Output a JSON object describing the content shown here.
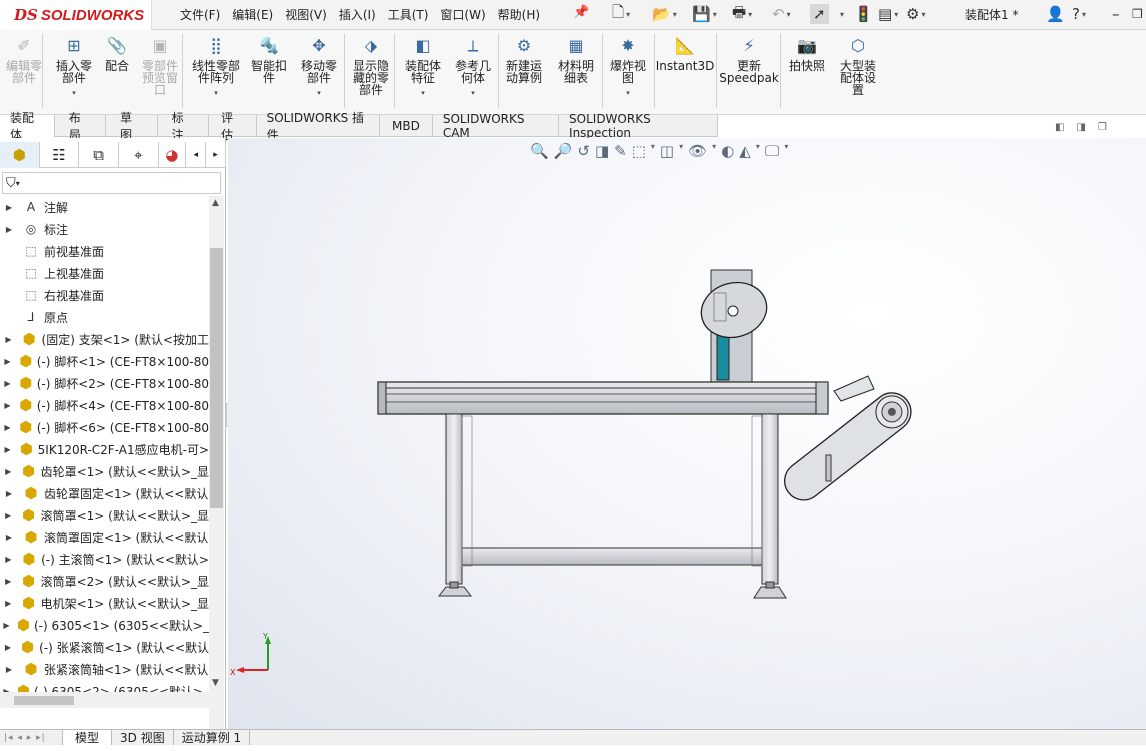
{
  "app": {
    "logo_ds": "DS",
    "logo_name": "SOLIDWORKS",
    "doc_title": "装配体1 *"
  },
  "menu": [
    "文件(F)",
    "编辑(E)",
    "视图(V)",
    "插入(I)",
    "工具(T)",
    "窗口(W)",
    "帮助(H)"
  ],
  "ribbon": [
    {
      "label": "编辑零\n部件",
      "disabled": true,
      "icon": "edit-component-icon"
    },
    {
      "label": "插入零\n部件",
      "disabled": false,
      "icon": "insert-component-icon",
      "dropdown": true
    },
    {
      "label": "配合",
      "disabled": false,
      "icon": "mate-icon"
    },
    {
      "label": "零部件\n预览窗\n口",
      "disabled": true,
      "icon": "component-preview-icon"
    },
    {
      "label": "线性零部\n件阵列",
      "disabled": false,
      "icon": "linear-pattern-icon",
      "dropdown": true
    },
    {
      "label": "智能扣\n件",
      "disabled": false,
      "icon": "smart-fasteners-icon"
    },
    {
      "label": "移动零\n部件",
      "disabled": false,
      "icon": "move-component-icon",
      "dropdown": true
    },
    {
      "label": "显示隐\n藏的零\n部件",
      "disabled": false,
      "icon": "show-hidden-icon"
    },
    {
      "label": "装配体\n特征",
      "disabled": false,
      "icon": "assembly-features-icon",
      "dropdown": true
    },
    {
      "label": "参考几\n何体",
      "disabled": false,
      "icon": "reference-geometry-icon",
      "dropdown": true
    },
    {
      "label": "新建运\n动算例",
      "disabled": false,
      "icon": "motion-study-icon"
    },
    {
      "label": "材料明\n细表",
      "disabled": false,
      "icon": "bom-icon"
    },
    {
      "label": "爆炸视\n图",
      "disabled": false,
      "icon": "exploded-view-icon",
      "dropdown": true
    },
    {
      "label": "Instant3D",
      "disabled": false,
      "icon": "instant3d-icon"
    },
    {
      "label": "更新\nSpeedpak",
      "disabled": false,
      "icon": "speedpak-icon"
    },
    {
      "label": "拍快照",
      "disabled": false,
      "icon": "snapshot-icon"
    },
    {
      "label": "大型装\n配体设\n置",
      "disabled": false,
      "icon": "large-assembly-icon"
    }
  ],
  "tabs": [
    "装配体",
    "布局",
    "草图",
    "标注",
    "评估",
    "SOLIDWORKS 插件",
    "MBD",
    "SOLIDWORKS CAM",
    "SOLIDWORKS Inspection"
  ],
  "tree": [
    {
      "label": "注解",
      "kind": "annotation"
    },
    {
      "label": "标注",
      "kind": "dimxpert"
    },
    {
      "label": "前视基准面",
      "kind": "plane"
    },
    {
      "label": "上视基准面",
      "kind": "plane"
    },
    {
      "label": "右视基准面",
      "kind": "plane"
    },
    {
      "label": "原点",
      "kind": "origin"
    },
    {
      "label": "(固定) 支架<1> (默认<按加工",
      "kind": "part"
    },
    {
      "label": "(-) 脚杯<1> (CE-FT8×100-80",
      "kind": "part"
    },
    {
      "label": "(-) 脚杯<2> (CE-FT8×100-80",
      "kind": "part"
    },
    {
      "label": "(-) 脚杯<4> (CE-FT8×100-80",
      "kind": "part"
    },
    {
      "label": "(-) 脚杯<6> (CE-FT8×100-80",
      "kind": "part"
    },
    {
      "label": "5IK120R-C2F-A1感应电机-可>",
      "kind": "part"
    },
    {
      "label": "齿轮罩<1> (默认<<默认>_显",
      "kind": "part"
    },
    {
      "label": "齿轮罩固定<1> (默认<<默认",
      "kind": "part"
    },
    {
      "label": "滚筒罩<1> (默认<<默认>_显",
      "kind": "part"
    },
    {
      "label": "滚筒罩固定<1> (默认<<默认",
      "kind": "part"
    },
    {
      "label": "(-) 主滚筒<1> (默认<<默认>",
      "kind": "part"
    },
    {
      "label": "滚筒罩<2> (默认<<默认>_显",
      "kind": "part"
    },
    {
      "label": "电机架<1> (默认<<默认>_显",
      "kind": "part"
    },
    {
      "label": "(-) 6305<1> (6305<<默认>_",
      "kind": "part"
    },
    {
      "label": "(-) 张紧滚筒<1> (默认<<默认",
      "kind": "part"
    },
    {
      "label": "张紧滚筒轴<1> (默认<<默认",
      "kind": "part"
    },
    {
      "label": "(-) 6305<2> (6305<<默认>_",
      "kind": "part"
    }
  ],
  "bottom_tabs": [
    "模型",
    "3D 视图",
    "运动算例 1"
  ],
  "triad": {
    "x": "X",
    "y": "Y"
  }
}
